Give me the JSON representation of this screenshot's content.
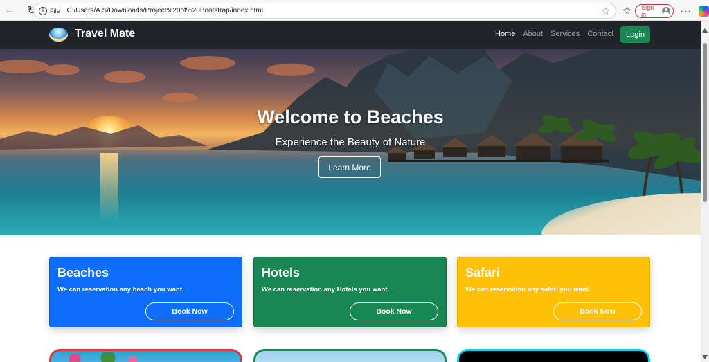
{
  "browser": {
    "file_label": "File",
    "url": "C:/Users/A.S/Downloads/Project%20of%20Bootstrap/index.html",
    "signin_label": "Sign in",
    "more_label": "···"
  },
  "site": {
    "brand": "Travel Mate",
    "nav": {
      "home": "Home",
      "about": "About",
      "services": "Services",
      "contact": "Contact"
    },
    "login_label": "Login"
  },
  "hero": {
    "title": "Welcome to Beaches",
    "subtitle": "Experience the Beauty of Nature",
    "button_label": "Learn More"
  },
  "cards": [
    {
      "title": "Beaches",
      "text": "We can reservation any beach you want.",
      "button": "Book Now",
      "color": "#0d6efd"
    },
    {
      "title": "Hotels",
      "text": "We can reservation any Hotels you want.",
      "button": "Book Now",
      "color": "#198754"
    },
    {
      "title": "Safari",
      "text": "We can reservation any safari you want.",
      "button": "Book Now",
      "color": "#ffc107"
    }
  ],
  "colors": {
    "navbar": "#212529",
    "login": "#198754",
    "photo_border_1": "#dc3545",
    "photo_border_2": "#198754",
    "photo_border_3": "#0dcaf0"
  },
  "icons": {
    "back": "back-arrow-icon",
    "reload": "reload-icon",
    "info": "info-icon",
    "star": "star-icon",
    "favorites": "favorites-icon",
    "profile": "profile-icon",
    "copilot": "copilot-icon"
  }
}
